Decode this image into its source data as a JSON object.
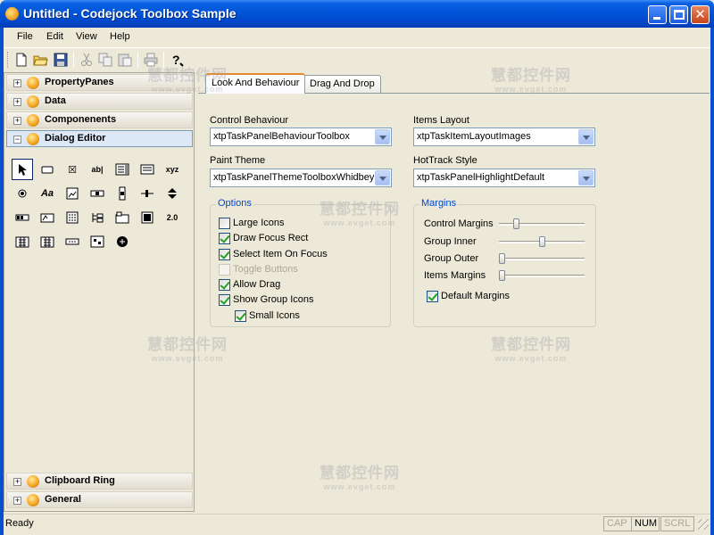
{
  "window": {
    "title": "Untitled - Codejock Toolbox Sample",
    "minimize_icon": "minimize-icon",
    "maximize_icon": "maximize-icon",
    "close_icon": "close-icon",
    "close_glyph": "✕"
  },
  "menu": {
    "file": "File",
    "edit": "Edit",
    "view": "View",
    "help": "Help"
  },
  "toolbar": {
    "icons": [
      "new-icon",
      "open-icon",
      "save-icon",
      "cut-icon",
      "copy-icon",
      "paste-icon",
      "print-icon",
      "help-icon"
    ]
  },
  "toolbox": {
    "groups_top": [
      {
        "label": "PropertyPanes",
        "expander": "+"
      },
      {
        "label": "Data",
        "expander": "+"
      },
      {
        "label": "Componenents",
        "expander": "+"
      },
      {
        "label": "Dialog Editor",
        "expander": "−"
      }
    ],
    "groups_bottom": [
      {
        "label": "Clipboard Ring",
        "expander": "+"
      },
      {
        "label": "General",
        "expander": "+"
      }
    ],
    "tools": [
      {
        "name": "pointer-tool",
        "glyph": ""
      },
      {
        "name": "button-tool",
        "glyph": ""
      },
      {
        "name": "checkbox-tool",
        "glyph": "☒"
      },
      {
        "name": "edit-tool",
        "glyph": "ab|"
      },
      {
        "name": "combobox-tool",
        "glyph": ""
      },
      {
        "name": "listbox-tool",
        "glyph": ""
      },
      {
        "name": "groupbox-tool",
        "glyph": "xyz"
      },
      {
        "name": "radio-tool",
        "glyph": ""
      },
      {
        "name": "static-text-tool",
        "glyph": "Aa"
      },
      {
        "name": "picture-tool",
        "glyph": ""
      },
      {
        "name": "hscroll-tool",
        "glyph": ""
      },
      {
        "name": "vscroll-tool",
        "glyph": ""
      },
      {
        "name": "slider-tool",
        "glyph": ""
      },
      {
        "name": "spin-tool",
        "glyph": ""
      },
      {
        "name": "progress-tool",
        "glyph": ""
      },
      {
        "name": "hotkey-tool",
        "glyph": ""
      },
      {
        "name": "listctrl-tool",
        "glyph": ""
      },
      {
        "name": "treectrl-tool",
        "glyph": ""
      },
      {
        "name": "tabctrl-tool",
        "glyph": ""
      },
      {
        "name": "animate-tool",
        "glyph": ""
      },
      {
        "name": "richedit-tool",
        "glyph": "2.0"
      },
      {
        "name": "datetime-tool",
        "glyph": ""
      },
      {
        "name": "monthcal-tool",
        "glyph": ""
      },
      {
        "name": "ipaddress-tool",
        "glyph": ""
      },
      {
        "name": "customctrl-tool",
        "glyph": ""
      },
      {
        "name": "syslink-tool",
        "glyph": ""
      }
    ]
  },
  "tabs": [
    {
      "label": "Look And Behaviour",
      "active": true
    },
    {
      "label": "Drag And Drop",
      "active": false
    }
  ],
  "look": {
    "control_behaviour_label": "Control Behaviour",
    "control_behaviour_value": "xtpTaskPanelBehaviourToolbox",
    "items_layout_label": "Items Layout",
    "items_layout_value": "xtpTaskItemLayoutImages",
    "paint_theme_label": "Paint Theme",
    "paint_theme_value": "xtpTaskPanelThemeToolboxWhidbey",
    "hottrack_label": "HotTrack Style",
    "hottrack_value": "xtpTaskPanelHighlightDefault",
    "options_title": "Options",
    "options": [
      {
        "label": "Large Icons",
        "checked": false,
        "disabled": false
      },
      {
        "label": "Draw Focus Rect",
        "checked": true,
        "disabled": false
      },
      {
        "label": "Select Item On Focus",
        "checked": true,
        "disabled": false
      },
      {
        "label": "Toggle Buttons",
        "checked": false,
        "disabled": true
      },
      {
        "label": "Allow Drag",
        "checked": true,
        "disabled": false
      },
      {
        "label": "Show Group Icons",
        "checked": true,
        "disabled": false
      },
      {
        "label": "Small Icons",
        "checked": true,
        "disabled": false
      }
    ],
    "margins_title": "Margins",
    "margins": [
      {
        "label": "Control Margins",
        "level": 0.18
      },
      {
        "label": "Group Inner",
        "level": 0.5
      },
      {
        "label": "Group Outer",
        "level": 0.0
      },
      {
        "label": "Items Margins",
        "level": 0.0
      }
    ],
    "default_margins_label": "Default Margins",
    "default_margins_checked": true
  },
  "status": {
    "text": "Ready",
    "cap": "CAP",
    "num": "NUM",
    "scrl": "SCRL",
    "cap_active": false,
    "num_active": true,
    "scrl_active": false
  },
  "watermark": {
    "cn": "慧都控件网",
    "en": "www.evget.com"
  },
  "colors": {
    "titlebar": "#0254d8",
    "group_title": "#0046d5",
    "check": "#21a121",
    "active_tab_accent": "#e68b2c"
  }
}
